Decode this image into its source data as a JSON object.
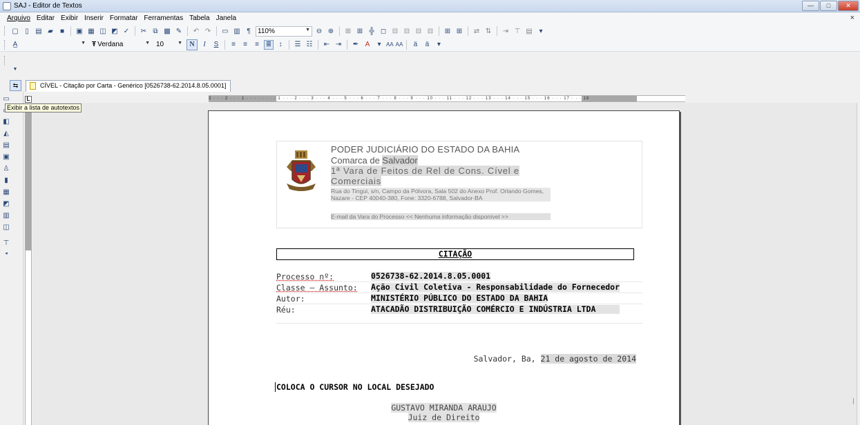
{
  "window": {
    "title": "SAJ - Editor de Textos",
    "buttons": {
      "minimize": "—",
      "maximize": "□",
      "close": "✕"
    }
  },
  "menubar": {
    "items": [
      "Arquivo",
      "Editar",
      "Exibir",
      "Inserir",
      "Formatar",
      "Ferramentas",
      "Tabela",
      "Janela"
    ],
    "close_glyph": "×"
  },
  "toolbar": {
    "zoom": "110%",
    "font_name": "Verdana",
    "font_size": "10",
    "bold": "N",
    "italic": "I",
    "underline": "S",
    "small_caps_a": "AA",
    "small_caps_b": "AA"
  },
  "tabs": {
    "document_tab": "CÍVEL - Citação por Carta - Genérico [0526738-62.2014.8.05.0001]"
  },
  "tooltip": "Exibir a lista de autotextos",
  "ruler": {
    "corner": "L",
    "ticks": "3 · · · 2 · · · 1 · · · · ·  · · · 1 · · · 2 · · · 3 · · · 4 · · · 5 · · · 6 · · · 7 · · · 8 · · · 9 · · · 10 · · · 11 · · · 12 · · · 13 · · · 14 · · · 15 · · · 16 · · · 17 · · · 18"
  },
  "document": {
    "court": "PODER JUDICIÁRIO DO ESTADO DA BAHIA",
    "district_prefix": "Comarca de ",
    "district_city": "Salvador",
    "vara": "1ª Vara de Feitos de Rel de Cons. Cível e Comerciais",
    "address": "Rua do Tingui, s/n, Campo da Pólvora, Sala 502 do Anexo Prof. Orlando Gomes, Nazare - CEP 40040-380, Fone: 3320-6788, Salvador-BA",
    "email": "E-mail da Vara do Processo << Nenhuma informação disponível >>",
    "citation_title": "CITAÇÃO",
    "fields": [
      {
        "label": "Processo nº:",
        "value": "0526738-62.2014.8.05.0001"
      },
      {
        "label": "Classe – Assunto:",
        "value": "Ação Civil Coletiva - Responsabilidade do Fornecedor"
      },
      {
        "label": "Autor:",
        "value": "MINISTÉRIO PÚBLICO DO ESTADO DA BAHIA"
      },
      {
        "label": "Réu:",
        "value": "ATACADÃO DISTRIBUIÇÃO COMÉRCIO E INDÚSTRIA LTDA"
      }
    ],
    "date_prefix": "Salvador, Ba, ",
    "date_value": "21 de agosto de 2014",
    "cursor_text": "COLOCA O CURSOR NO LOCAL DESEJADO",
    "signer_name": "GUSTAVO MIRANDA ARAUJO",
    "signer_role": "Juiz de Direito"
  }
}
